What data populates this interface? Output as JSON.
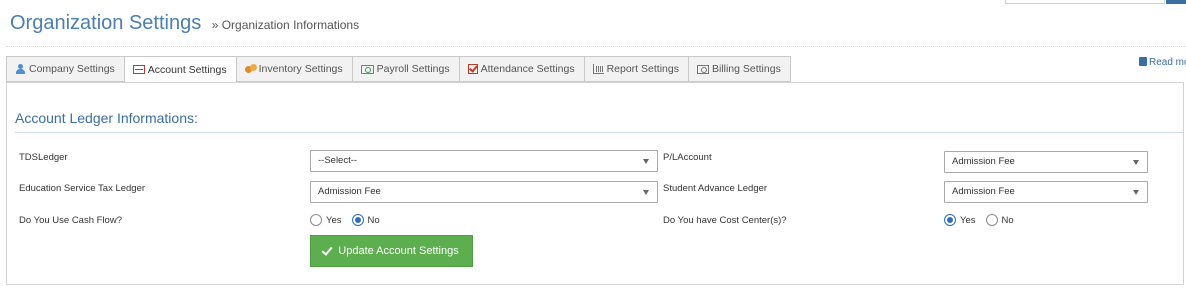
{
  "header": {
    "title": "Organization Settings",
    "breadcrumb": "» Organization Informations"
  },
  "tabs": [
    {
      "label": "Company Settings",
      "icon": "user-icon",
      "active": false
    },
    {
      "label": "Account Settings",
      "icon": "ledger-book-icon",
      "active": true
    },
    {
      "label": "Inventory Settings",
      "icon": "coins-icon",
      "active": false
    },
    {
      "label": "Payroll Settings",
      "icon": "money-icon",
      "active": false
    },
    {
      "label": "Attendance Settings",
      "icon": "checkbox-icon",
      "active": false
    },
    {
      "label": "Report Settings",
      "icon": "bar-chart-icon",
      "active": false
    },
    {
      "label": "Billing Settings",
      "icon": "bill-icon",
      "active": false
    }
  ],
  "read_more": "Read mo",
  "section": {
    "title": "Account Ledger Informations:"
  },
  "form": {
    "tds_ledger": {
      "label": "TDSLedger",
      "value": "--Select--"
    },
    "pl_account": {
      "label": "P/LAccount",
      "value": "Admission Fee"
    },
    "education_tax_ledger": {
      "label": "Education Service Tax Ledger",
      "value": "Admission Fee"
    },
    "student_advance_ledger": {
      "label": "Student Advance Ledger",
      "value": "Admission Fee"
    },
    "cash_flow": {
      "label": "Do You Use Cash Flow?",
      "options": [
        "Yes",
        "No"
      ],
      "selected": "No"
    },
    "cost_center": {
      "label": "Do You have Cost Center(s)?",
      "options": [
        "Yes",
        "No"
      ],
      "selected": "Yes"
    }
  },
  "update_button": "Update Account Settings",
  "colors": {
    "accent": "#3a6ea5",
    "button": "#5cae4e"
  }
}
